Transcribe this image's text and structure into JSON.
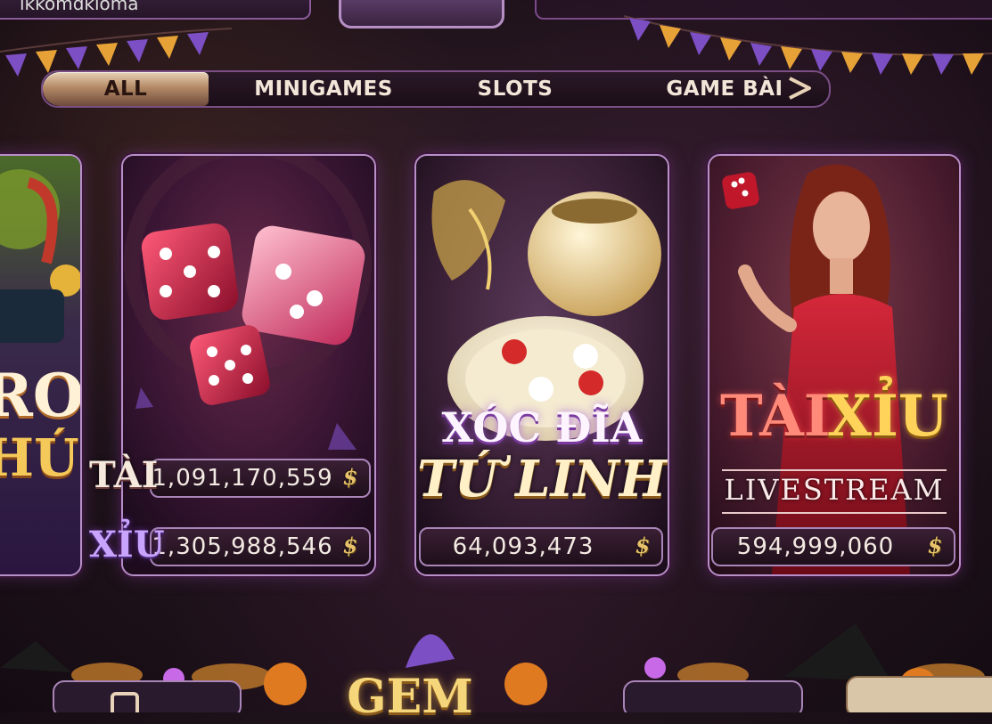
{
  "header": {
    "username_fragment": "ikkomdkloma"
  },
  "tabs": [
    {
      "label": "ALL",
      "active": true
    },
    {
      "label": "MINIGAMES",
      "active": false
    },
    {
      "label": "SLOTS",
      "active": false
    },
    {
      "label": "GAME BÀI",
      "active": false
    }
  ],
  "cards": {
    "partial_left": {
      "title_line1": "RO",
      "title_line2": "HÚ"
    },
    "tai_xiu_dice": {
      "tai_label": "TÀI",
      "xiu_label": "XỈU",
      "tai_value": "1,091,170,559",
      "xiu_value": "1,305,988,546"
    },
    "xoc_dia": {
      "title_line1": "XÓC ĐĨA",
      "title_line2": "TỨ LINH",
      "jackpot": "64,093,473"
    },
    "tai_xiu_live": {
      "title_tai": "TÀI",
      "title_xiu": "XỈU",
      "subtitle": "LIVESTREAM",
      "jackpot": "594,999,060"
    }
  },
  "coin_symbol": "$",
  "footer": {
    "logo_text": "GEM"
  },
  "colors": {
    "accent_purple": "#b890c8",
    "gold": "#e8c26a",
    "tab_active": "#d9bc9b",
    "background": "#20131c"
  },
  "icons": [
    "dice-icon",
    "coin-icon",
    "chevron-right-icon",
    "home-icon"
  ]
}
